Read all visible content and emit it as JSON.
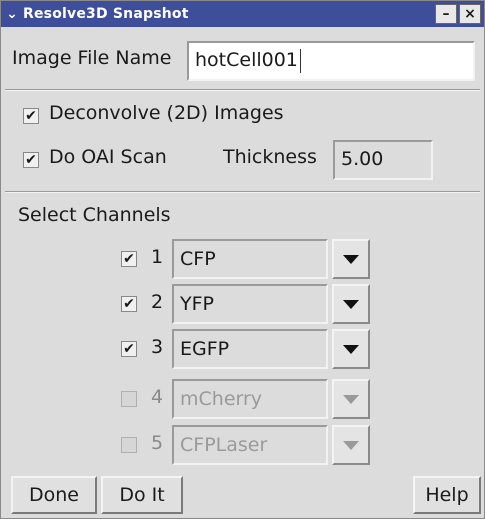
{
  "window": {
    "title": "Resolve3D Snapshot",
    "menu_icon": "chevron-down-icon",
    "minimize_icon": "minimize-icon",
    "close_icon": "close-icon",
    "minimize_glyph": "–",
    "close_glyph": "×",
    "titlebar_color": "#3f4e9a"
  },
  "image_file": {
    "label": "Image File Name",
    "value": "hotCell001"
  },
  "options": {
    "deconvolve": {
      "label": "Deconvolve (2D) Images",
      "checked": true
    },
    "oai_scan": {
      "label": "Do OAI Scan",
      "checked": true
    },
    "thickness_label": "Thickness",
    "thickness_value": "5.00"
  },
  "channels": {
    "heading": "Select Channels",
    "items": [
      {
        "number": "1",
        "name": "CFP",
        "checked": true,
        "enabled": true
      },
      {
        "number": "2",
        "name": "YFP",
        "checked": true,
        "enabled": true
      },
      {
        "number": "3",
        "name": "EGFP",
        "checked": true,
        "enabled": true
      },
      {
        "number": "4",
        "name": "mCherry",
        "checked": false,
        "enabled": false
      },
      {
        "number": "5",
        "name": "CFPLaser",
        "checked": false,
        "enabled": false
      }
    ]
  },
  "footer": {
    "done": "Done",
    "do_it": "Do It",
    "help": "Help"
  },
  "glyphs": {
    "check": "✔"
  }
}
